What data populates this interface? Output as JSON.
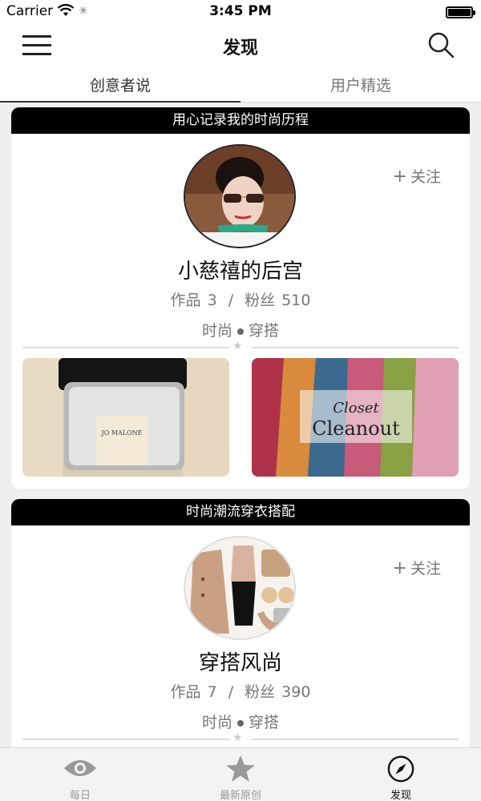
{
  "status_bar": {
    "carrier": "Carrier",
    "time": "3:45 PM"
  },
  "nav": {
    "title": "发现",
    "menu_icon": "hamburger-menu-icon",
    "search_icon": "search-icon"
  },
  "tabs": [
    {
      "label": "创意者说",
      "active": true
    },
    {
      "label": "用户精选",
      "active": false
    }
  ],
  "cards": [
    {
      "header": "用心记录我的时尚历程",
      "name": "小慈禧的后宫",
      "works_label": "作品",
      "works": "3",
      "fans_label": "粉丝",
      "fans": "510",
      "separator": "/",
      "tag1": "时尚",
      "tag2": "穿搭",
      "follow": "关注",
      "follow_plus": "+",
      "thumb_left_text": "JO MALONE",
      "thumb_right_text1": "Closet",
      "thumb_right_text2": "Cleanout"
    },
    {
      "header": "时尚潮流穿衣搭配",
      "name": "穿搭风尚",
      "works_label": "作品",
      "works": "7",
      "fans_label": "粉丝",
      "fans": "390",
      "separator": "/",
      "tag1": "时尚",
      "tag2": "穿搭",
      "follow": "关注",
      "follow_plus": "+"
    }
  ],
  "tab_bar": [
    {
      "label": "每日",
      "icon": "eye-icon",
      "active": false
    },
    {
      "label": "最新原创",
      "icon": "star-icon",
      "active": false
    },
    {
      "label": "发现",
      "icon": "compass-icon",
      "active": true
    }
  ]
}
